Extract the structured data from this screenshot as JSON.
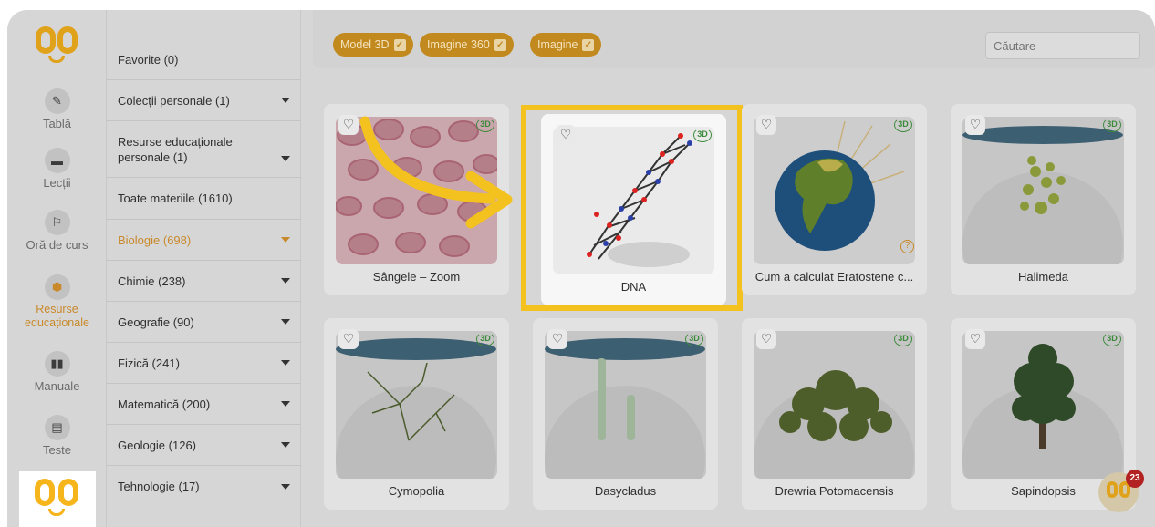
{
  "nav": {
    "items": [
      {
        "label": "Tablă",
        "icon": "pencil-icon"
      },
      {
        "label": "Lecții",
        "icon": "folder-icon"
      },
      {
        "label": "Oră de curs",
        "icon": "teacher-board-icon"
      },
      {
        "label": "Resurse educaționale",
        "icon": "cube-icon"
      },
      {
        "label": "Manuale",
        "icon": "book-icon"
      },
      {
        "label": "Teste",
        "icon": "document-icon"
      }
    ],
    "active": "Resurse educaționale"
  },
  "categories": [
    {
      "label": "Favorite (0)"
    },
    {
      "label": "Colecții personale (1)"
    },
    {
      "label": "Resurse educaționale personale (1)"
    },
    {
      "label": "Toate materiile (1610)"
    },
    {
      "label": "Biologie (698)"
    },
    {
      "label": "Chimie (238)"
    },
    {
      "label": "Geografie (90)"
    },
    {
      "label": "Fizică (241)"
    },
    {
      "label": "Matematică (200)"
    },
    {
      "label": "Geologie (126)"
    },
    {
      "label": "Tehnologie (17)"
    }
  ],
  "filters": [
    {
      "label": "Model 3D",
      "checked": true
    },
    {
      "label": "Imagine 360",
      "checked": true
    },
    {
      "label": "Imagine",
      "checked": true
    }
  ],
  "search": {
    "placeholder": "Căutare"
  },
  "badge_3d": "3D",
  "cards": [
    {
      "title": "Sângele – Zoom"
    },
    {
      "title": "DNA"
    },
    {
      "title": "Cum a calculat Eratostene c..."
    },
    {
      "title": "Halimeda"
    },
    {
      "title": "Cymopolia"
    },
    {
      "title": "Dasycladus"
    },
    {
      "title": "Drewria Potomacensis"
    },
    {
      "title": "Sapindopsis"
    }
  ],
  "chat": {
    "notification_count": "23"
  },
  "colors": {
    "accent": "#c9892a",
    "highlight": "#f3c21f",
    "chip": "#c28a1e",
    "overlay_gray": "#d6d6d6"
  }
}
